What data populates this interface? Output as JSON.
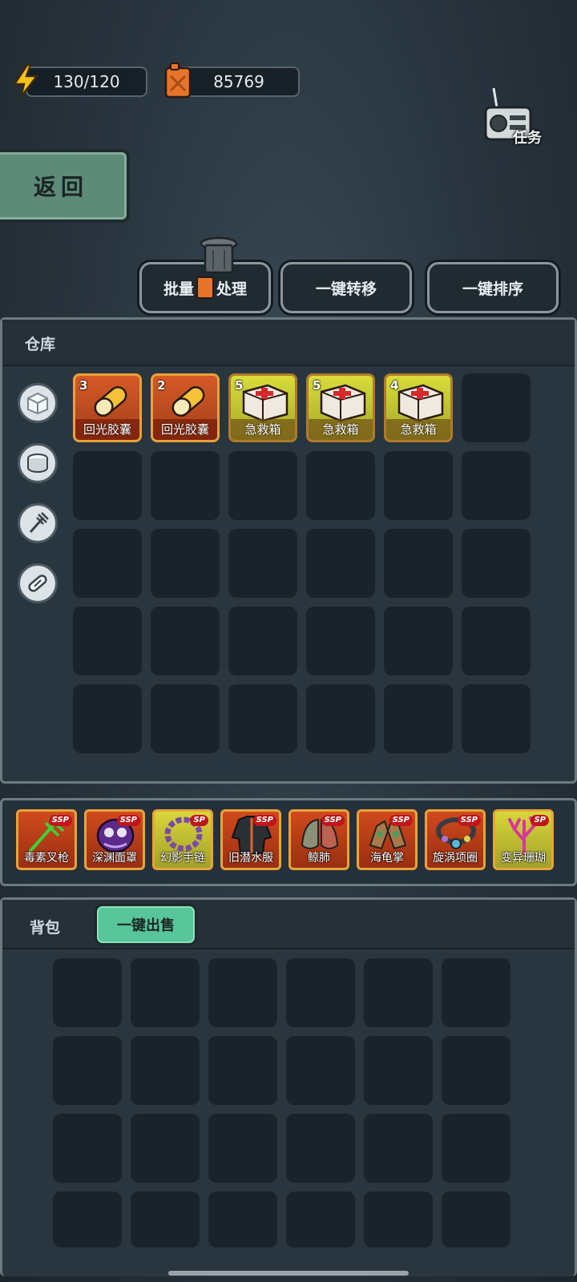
{
  "resources": {
    "energy": "130/120",
    "fuel": "85769"
  },
  "task_label": "任务",
  "back_label": "返回",
  "actions": {
    "batch_label_1": "批量",
    "batch_label_2": "处理",
    "transfer_label": "一键转移",
    "sort_label": "一键排序"
  },
  "warehouse": {
    "title": "仓库",
    "items": [
      {
        "count": "3",
        "name": "回光胶囊",
        "style": "orange",
        "icon": "capsule-icon"
      },
      {
        "count": "2",
        "name": "回光胶囊",
        "style": "orange",
        "icon": "capsule-icon"
      },
      {
        "count": "5",
        "name": "急救箱",
        "style": "yellow",
        "icon": "first-aid-kit-icon"
      },
      {
        "count": "5",
        "name": "急救箱",
        "style": "yellow",
        "icon": "first-aid-kit-icon"
      },
      {
        "count": "4",
        "name": "急救箱",
        "style": "yellow",
        "icon": "first-aid-kit-icon"
      }
    ],
    "categories": [
      "cube-icon",
      "can-icon",
      "trident-icon",
      "pill-icon"
    ]
  },
  "equipment": [
    {
      "name": "毒素叉枪",
      "rank": "SSP",
      "style": "red",
      "icon": "trident-weapon-icon"
    },
    {
      "name": "深渊面罩",
      "rank": "SSP",
      "style": "red",
      "icon": "mask-icon"
    },
    {
      "name": "幻影手链",
      "rank": "SP",
      "style": "yellow",
      "icon": "bracelet-icon"
    },
    {
      "name": "旧潜水服",
      "rank": "SSP",
      "style": "red",
      "icon": "diving-suit-icon"
    },
    {
      "name": "鲸肺",
      "rank": "SSP",
      "style": "red",
      "icon": "lung-icon"
    },
    {
      "name": "海龟掌",
      "rank": "SSP",
      "style": "red",
      "icon": "gauntlet-icon"
    },
    {
      "name": "旋涡项圈",
      "rank": "SSP",
      "style": "red",
      "icon": "collar-icon"
    },
    {
      "name": "变异珊瑚",
      "rank": "SP",
      "style": "yellow",
      "icon": "coral-icon"
    }
  ],
  "backpack": {
    "title": "背包",
    "sell_label": "一键出售"
  },
  "colors": {
    "accent_green": "#58c59a",
    "back_green": "#5e8a78",
    "rank_red": "#c0151a",
    "item_orange": "#d55a25",
    "item_yellow": "#d9dc3a"
  }
}
